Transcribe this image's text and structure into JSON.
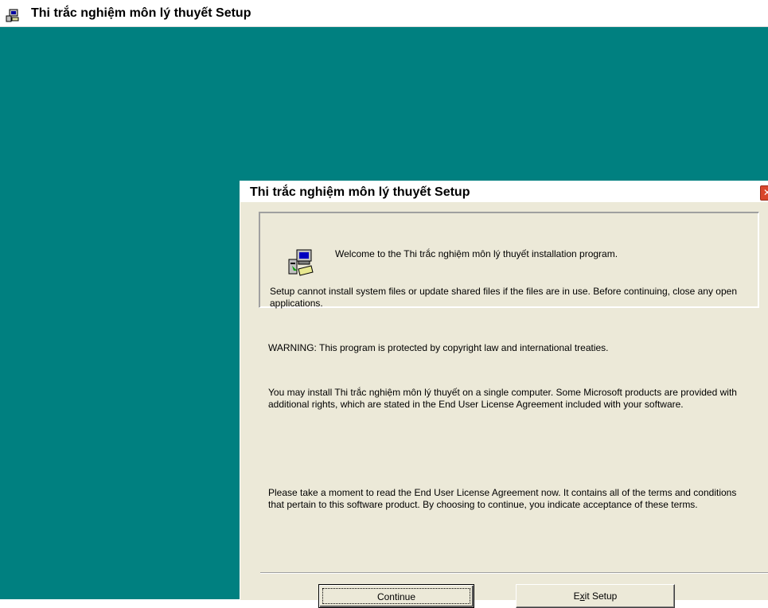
{
  "app_window": {
    "title": "Thi trắc nghiệm môn lý thuyết Setup",
    "icon": "setup-computer-icon"
  },
  "colors": {
    "desktop_background": "#008080",
    "dialog_face": "#ece9d8",
    "close_button": "#d9462c"
  },
  "dialog": {
    "title": "Thi trắc nghiệm môn lý thuyết Setup",
    "close_icon": "close-icon",
    "welcome_text": "Welcome to the Thi trắc nghiệm môn lý thuyết installation program.",
    "in_use_text": "Setup cannot install system files or update shared files if the files are in use. Before continuing, close any open applications.",
    "warning_text": "WARNING: This program is protected by copyright law and international treaties.",
    "rights_text": "You may install Thi trắc nghiệm môn lý thuyết on a single computer. Some Microsoft products are provided with additional rights, which are stated in the End User License Agreement included with your software.",
    "eula_text": "Please take a moment to read the End User License Agreement now. It contains all of the terms and conditions that pertain to this software product. By choosing to continue, you indicate acceptance of these terms.",
    "buttons": {
      "continue_label": "Continue",
      "exit_label_prefix": "E",
      "exit_label_mnemonic": "x",
      "exit_label_suffix": "it Setup"
    }
  }
}
